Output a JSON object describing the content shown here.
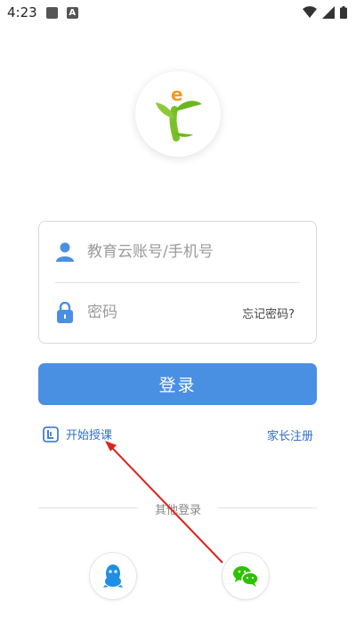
{
  "status_bar": {
    "time": "4:23"
  },
  "login": {
    "account_placeholder": "教育云账号/手机号",
    "password_placeholder": "密码",
    "forgot_password": "忘记密码?",
    "login_button": "登录"
  },
  "links": {
    "start_teaching": "开始授课",
    "parent_register": "家长注册"
  },
  "other_login": {
    "label": "其他登录",
    "options": [
      {
        "icon": "qq-icon"
      },
      {
        "icon": "wechat-icon"
      }
    ]
  },
  "colors": {
    "primary": "#4a90e2",
    "link": "#2f6fc6",
    "wechat": "#2dc100",
    "qq": "#1f8fe5",
    "annotation_arrow": "#d9231f"
  }
}
